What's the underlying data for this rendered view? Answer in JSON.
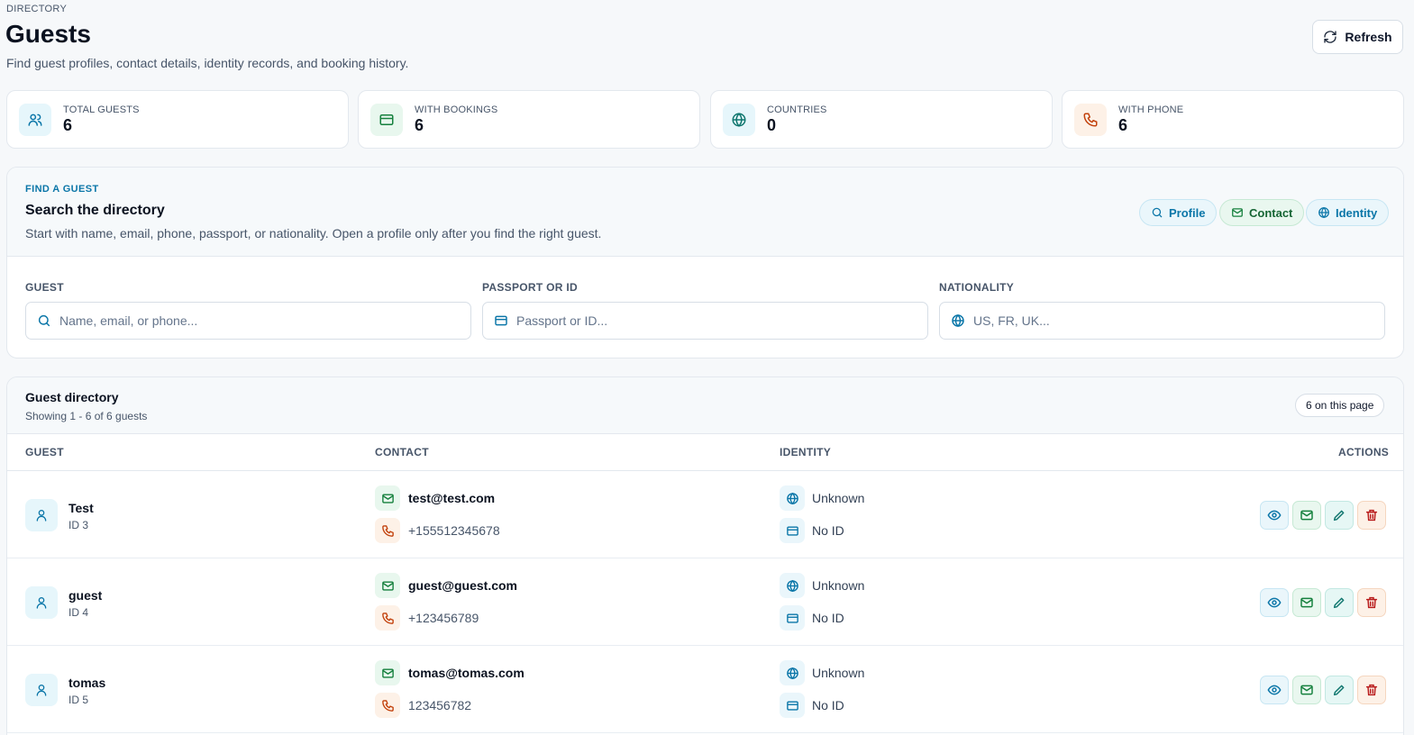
{
  "header": {
    "eyebrow": "DIRECTORY",
    "title": "Guests",
    "subtitle": "Find guest profiles, contact details, identity records, and booking history.",
    "refresh_label": "Refresh"
  },
  "stats": [
    {
      "label": "TOTAL GUESTS",
      "value": "6",
      "icon": "users-icon"
    },
    {
      "label": "WITH BOOKINGS",
      "value": "6",
      "icon": "card-icon"
    },
    {
      "label": "COUNTRIES",
      "value": "0",
      "icon": "globe-icon"
    },
    {
      "label": "WITH PHONE",
      "value": "6",
      "icon": "phone-icon"
    }
  ],
  "search": {
    "eyebrow": "FIND A GUEST",
    "title": "Search the directory",
    "description": "Start with name, email, phone, passport, or nationality. Open a profile only after you find the right guest.",
    "pills": [
      "Profile",
      "Contact",
      "Identity"
    ],
    "fields": [
      {
        "label": "GUEST",
        "placeholder": "Name, email, or phone...",
        "value": ""
      },
      {
        "label": "PASSPORT OR ID",
        "placeholder": "Passport or ID...",
        "value": ""
      },
      {
        "label": "NATIONALITY",
        "placeholder": "US, FR, UK...",
        "value": ""
      }
    ]
  },
  "directory": {
    "title": "Guest directory",
    "subtitle": "Showing 1 - 6 of 6 guests",
    "badge": "6 on this page",
    "columns": [
      "GUEST",
      "CONTACT",
      "IDENTITY",
      "ACTIONS"
    ],
    "rows": [
      {
        "name": "Test",
        "id": "ID 3",
        "email": "test@test.com",
        "phone": "+155512345678",
        "nationality": "Unknown",
        "document": "No ID"
      },
      {
        "name": "guest",
        "id": "ID 4",
        "email": "guest@guest.com",
        "phone": "+123456789",
        "nationality": "Unknown",
        "document": "No ID"
      },
      {
        "name": "tomas",
        "id": "ID 5",
        "email": "tomas@tomas.com",
        "phone": "123456782",
        "nationality": "Unknown",
        "document": "No ID"
      }
    ]
  },
  "colors": {
    "accent": "#0b76a8",
    "green": "#15803d",
    "orange": "#c2410c",
    "red": "#b91c1c",
    "teal": "#0f766e"
  }
}
